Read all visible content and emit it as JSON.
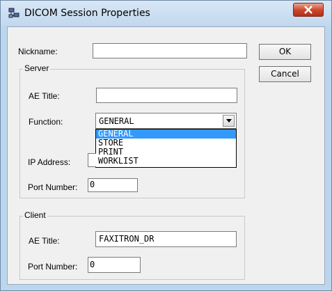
{
  "window": {
    "title": "DICOM Session Properties",
    "close_glyph": "X"
  },
  "form": {
    "nickname_label": "Nickname:",
    "nickname_value": "",
    "ok_label": "OK",
    "cancel_label": "Cancel"
  },
  "server": {
    "group_label": "Server",
    "ae_title_label": "AE Title:",
    "ae_title_value": "",
    "function_label": "Function:",
    "function_value": "GENERAL",
    "function_options": [
      "GENERAL",
      "STORE",
      "PRINT",
      "WORKLIST"
    ],
    "ip_label": "IP Address:",
    "port_label": "Port Number:",
    "port_value": "0"
  },
  "client": {
    "group_label": "Client",
    "ae_title_label": "AE Title:",
    "ae_title_value": "FAXITRON_DR",
    "port_label": "Port Number:",
    "port_value": "0"
  },
  "colors": {
    "selection": "#3399ff",
    "close_button": "#c9452c"
  }
}
